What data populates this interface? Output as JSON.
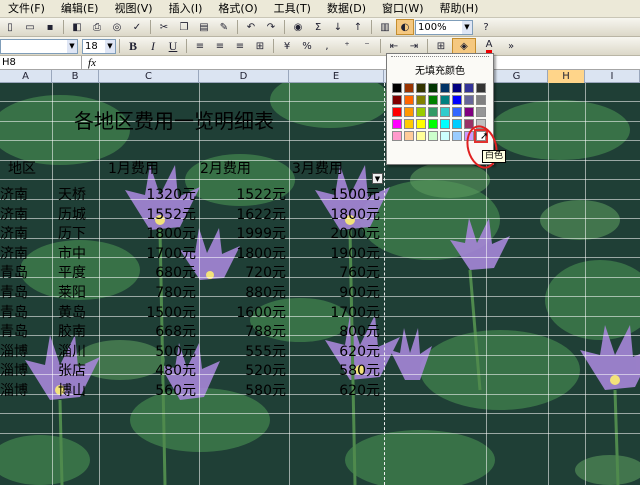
{
  "menu": [
    "文件(F)",
    "编辑(E)",
    "视图(V)",
    "插入(I)",
    "格式(O)",
    "工具(T)",
    "数据(D)",
    "窗口(W)",
    "帮助(H)"
  ],
  "toolbar": {
    "zoom": "100%",
    "font_size": "18",
    "bold": "B",
    "italic": "I",
    "underline": "U",
    "percent": "%",
    "sigma": "Σ"
  },
  "formula_bar": {
    "name_box": "H8",
    "fx": "fx"
  },
  "columns": [
    "A",
    "B",
    "C",
    "D",
    "E",
    "F",
    "G",
    "H",
    "I"
  ],
  "sheet": {
    "title": "各地区费用一览明细表",
    "headers": [
      "地区",
      "1月费用",
      "2月费用",
      "3月费用"
    ],
    "rows": [
      [
        "济南",
        "天桥",
        "1320元",
        "1522元",
        "1500元"
      ],
      [
        "济南",
        "历城",
        "1552元",
        "1622元",
        "1800元"
      ],
      [
        "济南",
        "历下",
        "1800元",
        "1999元",
        "2000元"
      ],
      [
        "济南",
        "市中",
        "1700元",
        "1800元",
        "1900元"
      ],
      [
        "青岛",
        "平度",
        "680元",
        "720元",
        "760元"
      ],
      [
        "青岛",
        "莱阳",
        "780元",
        "880元",
        "900元"
      ],
      [
        "青岛",
        "黄岛",
        "1500元",
        "1600元",
        "1700元"
      ],
      [
        "青岛",
        "胶南",
        "668元",
        "788元",
        "800元"
      ],
      [
        "淄博",
        "淄川",
        "500元",
        "555元",
        "620元"
      ],
      [
        "淄博",
        "张店",
        "480元",
        "520元",
        "580元"
      ],
      [
        "淄博",
        "博山",
        "560元",
        "580元",
        "620元"
      ]
    ]
  },
  "palette": {
    "no_fill": "无填充颜色",
    "tooltip": "白色",
    "rows": [
      [
        "#000000",
        "#993300",
        "#333300",
        "#003300",
        "#003366",
        "#000080",
        "#333399",
        "#333333"
      ],
      [
        "#800000",
        "#FF6600",
        "#808000",
        "#008000",
        "#008080",
        "#0000FF",
        "#666699",
        "#808080"
      ],
      [
        "#FF0000",
        "#FF9900",
        "#99CC00",
        "#339966",
        "#33CCCC",
        "#3366FF",
        "#800080",
        "#969696"
      ],
      [
        "#FF00FF",
        "#FFCC00",
        "#FFFF00",
        "#00FF00",
        "#00FFFF",
        "#00CCFF",
        "#993366",
        "#C0C0C0"
      ],
      [
        "#FF99CC",
        "#FFCC99",
        "#FFFF99",
        "#CCFFCC",
        "#CCFFFF",
        "#99CCFF",
        "#CC99FF",
        "#FFFFFF"
      ]
    ]
  },
  "colors": {
    "highlight": "#e1322f",
    "header_bg": "#dbe4f2"
  }
}
